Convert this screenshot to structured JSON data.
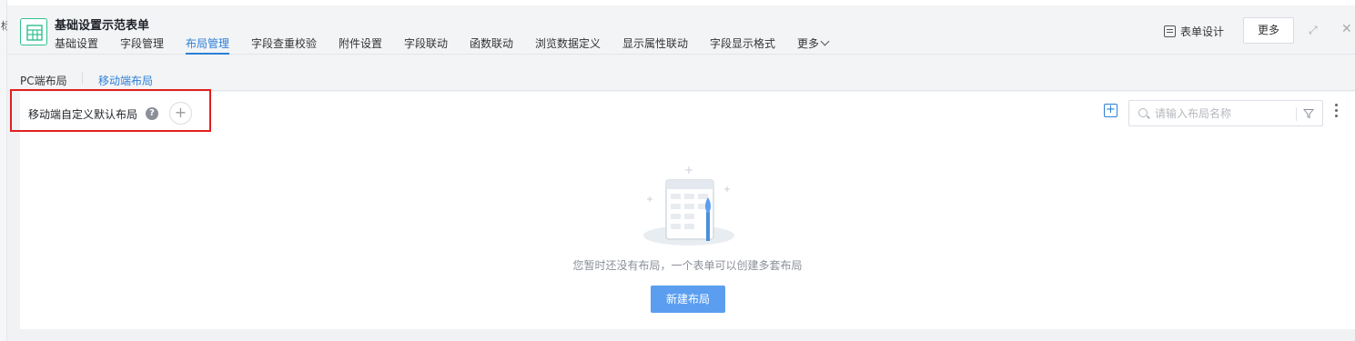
{
  "window": {
    "left_strip_text": "标",
    "title": "基础设置示范表单",
    "icon": "table-grid-icon",
    "accent_color": "#2d7fd6",
    "form_icon_color": "#2fbf8e"
  },
  "tabs": [
    {
      "label": "基础设置",
      "active": false
    },
    {
      "label": "字段管理",
      "active": false
    },
    {
      "label": "布局管理",
      "active": true
    },
    {
      "label": "字段查重校验",
      "active": false
    },
    {
      "label": "附件设置",
      "active": false
    },
    {
      "label": "字段联动",
      "active": false
    },
    {
      "label": "函数联动",
      "active": false
    },
    {
      "label": "浏览数据定义",
      "active": false
    },
    {
      "label": "显示属性联动",
      "active": false
    },
    {
      "label": "字段显示格式",
      "active": false
    },
    {
      "label": "更多",
      "active": false
    }
  ],
  "header_actions": {
    "design_label": "表单设计",
    "more_label": "更多"
  },
  "subtabs": [
    {
      "label": "PC端布局",
      "active": false
    },
    {
      "label": "移动端布局",
      "active": true
    }
  ],
  "layout_section": {
    "title": "移动端自定义默认布局",
    "help": "?",
    "add": "+"
  },
  "toolbar": {
    "add": "+",
    "search_placeholder": "请输入布局名称"
  },
  "empty_state": {
    "message": "您暂时还没有布局，一个表单可以创建多套布局",
    "button_label": "新建布局",
    "button_color": "#5b9ef0"
  },
  "annotation": {
    "highlight_color": "#e02020"
  }
}
